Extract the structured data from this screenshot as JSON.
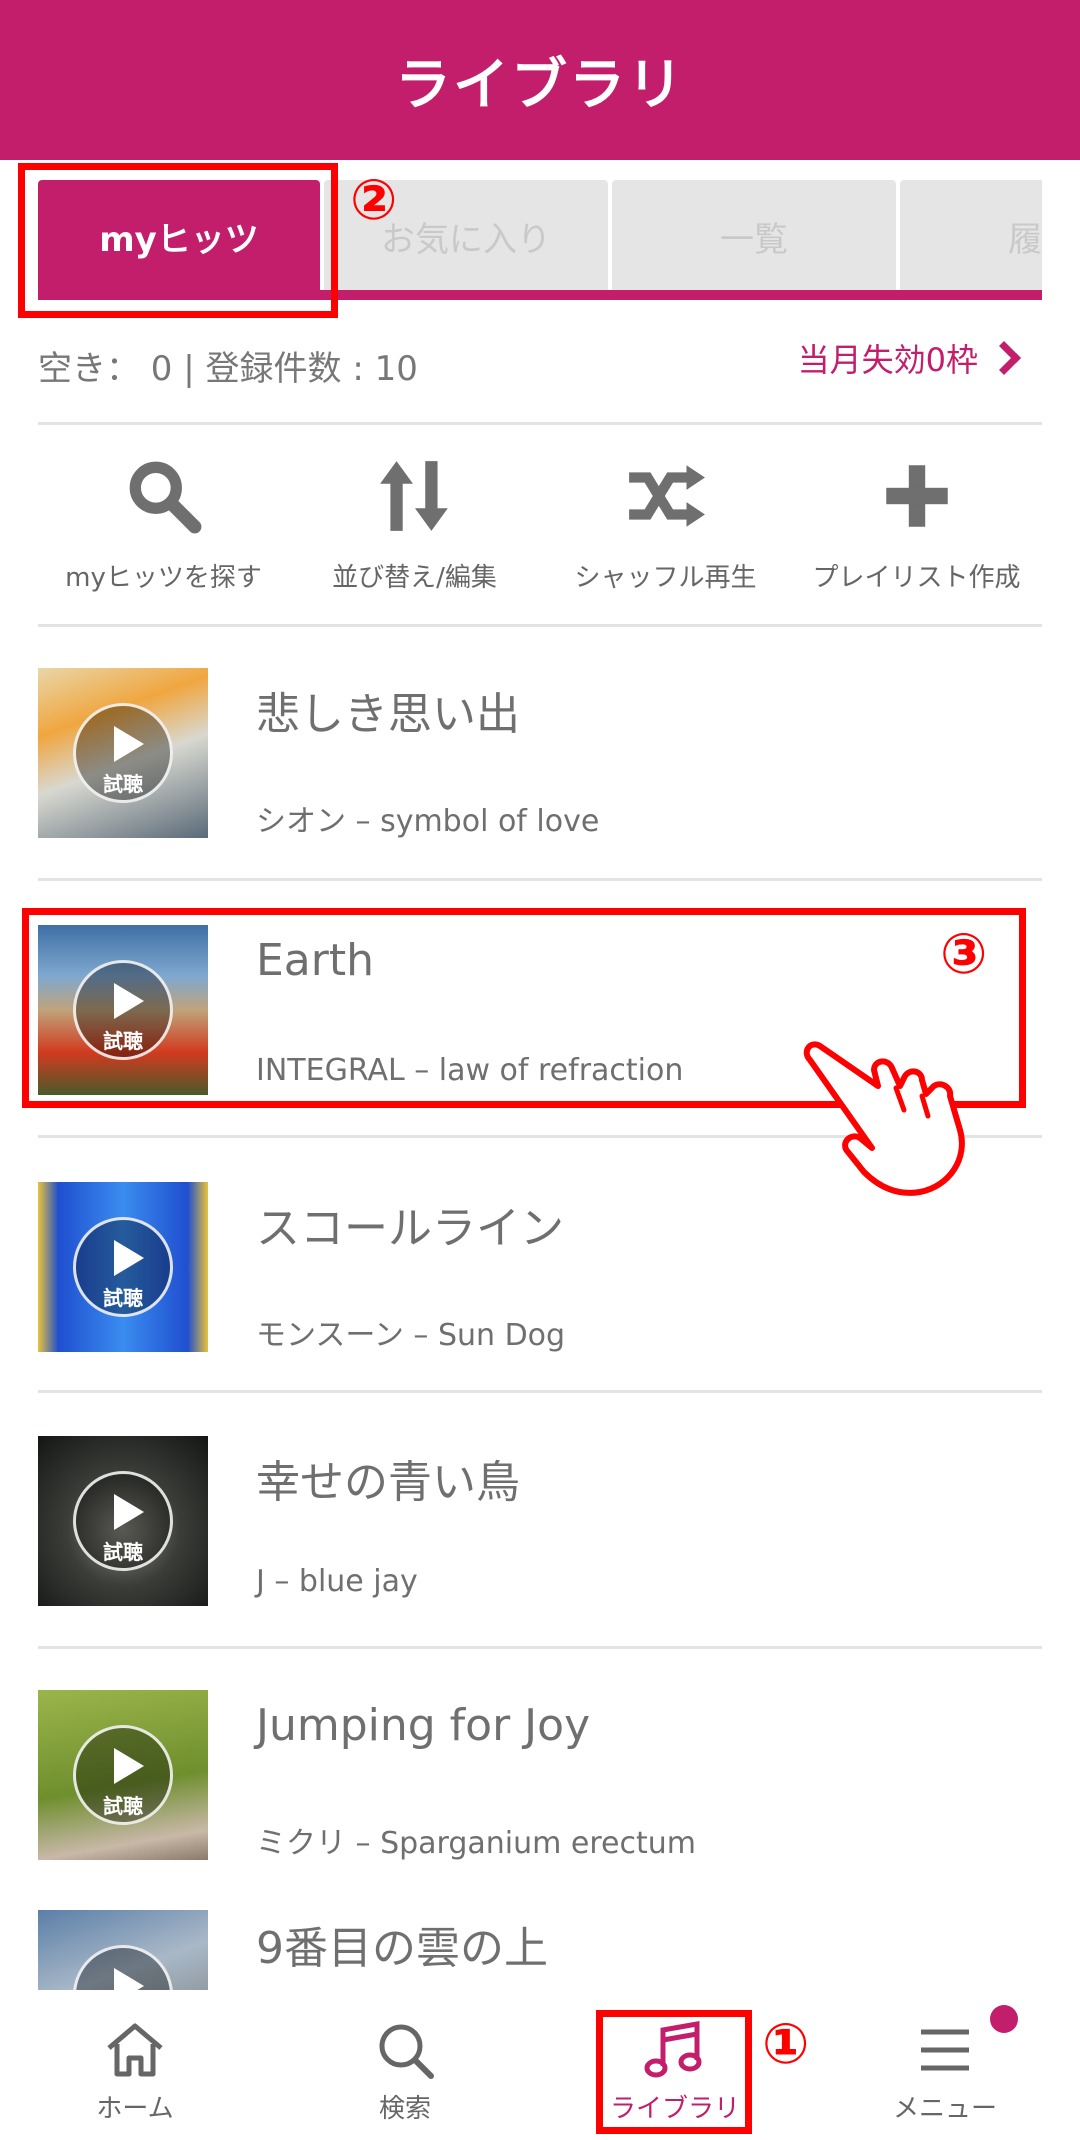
{
  "header": {
    "title": "ライブラリ"
  },
  "tabs": [
    {
      "label": "myヒッツ",
      "active": true
    },
    {
      "label": "お気に入り",
      "active": false
    },
    {
      "label": "一覧",
      "active": false
    },
    {
      "label": "履",
      "active": false
    }
  ],
  "stats": {
    "summary": "空き： 0 | 登録件数 : 10",
    "expiry_link": "当月失効0枠"
  },
  "actions": [
    {
      "label": "myヒッツを探す",
      "icon": "search-icon"
    },
    {
      "label": "並び替え/編集",
      "icon": "sort-icon"
    },
    {
      "label": "シャッフル再生",
      "icon": "shuffle-icon"
    },
    {
      "label": "プレイリスト作成",
      "icon": "plus-icon"
    }
  ],
  "preview_label": "試聴",
  "tracks": [
    {
      "title": "悲しき思い出",
      "artist_album": "シオン – symbol of love"
    },
    {
      "title": "Earth",
      "artist_album": "INTEGRAL – law of refraction"
    },
    {
      "title": "スコールライン",
      "artist_album": "モンスーン – Sun Dog"
    },
    {
      "title": "幸せの青い鳥",
      "artist_album": "J –  blue jay"
    },
    {
      "title": "Jumping for Joy",
      "artist_album": "ミクリ –  Sparganium erectum"
    },
    {
      "title": "9番目の雲の上",
      "artist_album": ""
    }
  ],
  "bottom_nav": [
    {
      "label": "ホーム",
      "icon": "home-icon"
    },
    {
      "label": "検索",
      "icon": "search-icon"
    },
    {
      "label": "ライブラリ",
      "icon": "music-note-icon",
      "active": true
    },
    {
      "label": "メニュー",
      "icon": "menu-icon"
    }
  ],
  "annotations": {
    "step1": "①",
    "step2": "②",
    "step3": "③"
  },
  "colors": {
    "brand": "#c21e6c",
    "annotation": "#ff0000"
  }
}
